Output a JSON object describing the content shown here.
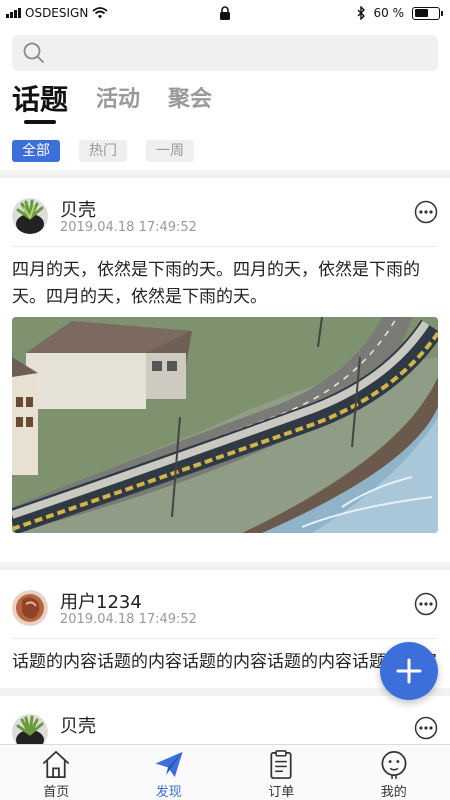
{
  "status_bar": {
    "carrier": "OSDESIGN",
    "battery": "60 %",
    "battery_level": 0.6
  },
  "tabs": [
    {
      "label": "话题",
      "active": true
    },
    {
      "label": "活动",
      "active": false
    },
    {
      "label": "聚会",
      "active": false
    }
  ],
  "filters": [
    {
      "label": "全部",
      "active": true
    },
    {
      "label": "热门",
      "active": false
    },
    {
      "label": "一周",
      "active": false
    }
  ],
  "posts": [
    {
      "username": "贝壳",
      "time": "2019.04.18 17:49:52",
      "text": "四月的天，依然是下雨的天。四月的天，依然是下雨的天。四月的天，依然是下雨的天。"
    },
    {
      "username": "用户1234",
      "time": "2019.04.18 17:49:52",
      "text": "话题的内容话题的内容话题的内容话题的内容话题的内容"
    },
    {
      "username": "贝壳"
    }
  ],
  "bottom_nav": [
    {
      "label": "首页",
      "icon": "home-icon",
      "active": false
    },
    {
      "label": "发现",
      "icon": "paper-plane-icon",
      "active": true
    },
    {
      "label": "订单",
      "icon": "clipboard-icon",
      "active": false
    },
    {
      "label": "我的",
      "icon": "user-face-icon",
      "active": false
    }
  ],
  "colors": {
    "accent": "#3c6fd9",
    "separator": "#f2f2f2"
  }
}
